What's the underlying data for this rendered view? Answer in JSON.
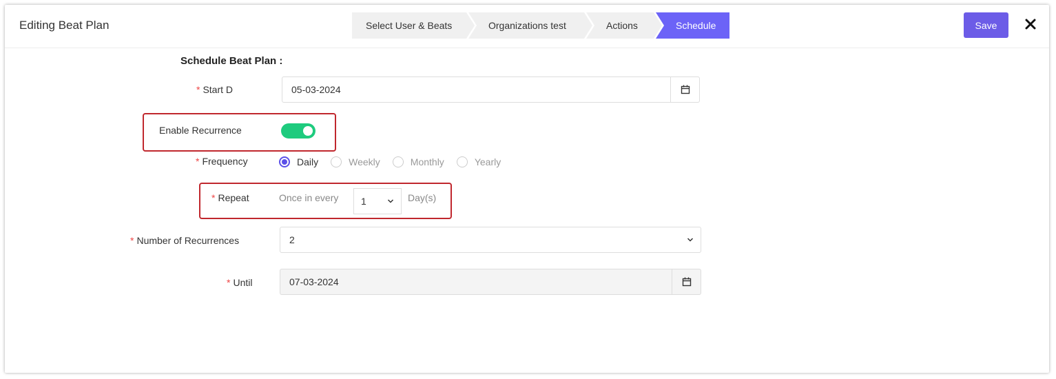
{
  "header": {
    "title": "Editing Beat Plan",
    "steps": [
      {
        "label": "Select User & Beats",
        "state": "done"
      },
      {
        "label": "Organizations test",
        "state": "done"
      },
      {
        "label": "Actions",
        "state": "done"
      },
      {
        "label": "Schedule",
        "state": "active"
      }
    ],
    "save_label": "Save",
    "close_icon": "close-icon"
  },
  "form": {
    "section_title": "Schedule Beat Plan :",
    "start_date": {
      "label": "Start D",
      "value": "05-03-2024",
      "icon": "calendar-icon"
    },
    "recurrence": {
      "label": "Enable Recurrence",
      "enabled": true
    },
    "frequency": {
      "label": "Frequency",
      "options": [
        "Daily",
        "Weekly",
        "Monthly",
        "Yearly"
      ],
      "selected": "Daily"
    },
    "repeat": {
      "label": "Repeat",
      "prefix": "Once in every",
      "value": "1",
      "suffix": "Day(s)"
    },
    "num_recurrences": {
      "label": "Number of Recurrences",
      "value": "2"
    },
    "until": {
      "label": "Until",
      "value": "07-03-2024",
      "icon": "calendar-icon"
    },
    "required_mark": "*"
  },
  "colors": {
    "accent": "#6c5ce7",
    "toggle_on": "#1ecb7e",
    "highlight": "#c0272d",
    "required": "#ee4444"
  }
}
